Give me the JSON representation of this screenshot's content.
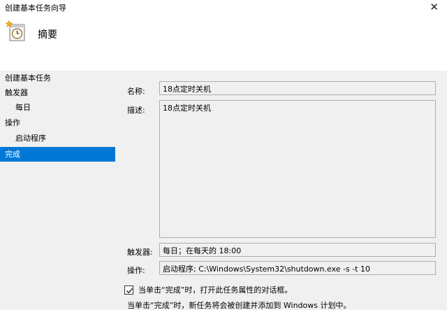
{
  "window": {
    "title": "创建基本任务向导",
    "close_glyph": "✕"
  },
  "header": {
    "icon": "clock-task-icon",
    "heading": "摘要"
  },
  "nav": {
    "items": [
      {
        "label": "创建基本任务",
        "level": 0,
        "selected": false
      },
      {
        "label": "触发器",
        "level": 0,
        "selected": false
      },
      {
        "label": "每日",
        "level": 1,
        "selected": false
      },
      {
        "label": "操作",
        "level": 0,
        "selected": false
      },
      {
        "label": "启动程序",
        "level": 1,
        "selected": false
      },
      {
        "label": "完成",
        "level": 0,
        "selected": true
      }
    ],
    "selected_color": "#0078d7"
  },
  "summary": {
    "name_label": "名称:",
    "name_value": "18点定时关机",
    "description_label": "描述:",
    "description_value": "18点定时关机",
    "trigger_label": "触发器:",
    "trigger_value": "每日；在每天的 18:00",
    "action_label": "操作:",
    "action_value": "启动程序; C:\\Windows\\System32\\shutdown.exe -s -t 10"
  },
  "options": {
    "open_properties_checked": true,
    "open_properties_label": "当单击“完成”时，打开此任务属性的对话框。"
  },
  "footer": {
    "note": "当单击“完成”时，新任务将会被创建并添加到 Windows 计划中。"
  }
}
